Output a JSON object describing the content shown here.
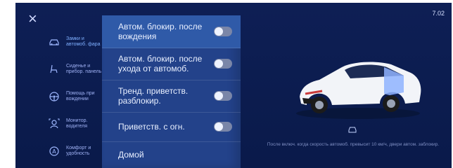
{
  "status": {
    "time": "7.02"
  },
  "close_icon": "close-icon",
  "sidebar": {
    "items": [
      {
        "label": "Замки и автомоб. фара",
        "icon": "car-lock-icon",
        "active": true
      },
      {
        "label": "Сиденье и прибор. панель",
        "icon": "seat-icon",
        "active": false
      },
      {
        "label": "Помощь при вождении",
        "icon": "steering-wheel-icon",
        "active": false
      },
      {
        "label": "Монитор. водителя",
        "icon": "driver-monitor-icon",
        "active": false
      },
      {
        "label": "Комфорт и удобность",
        "icon": "comfort-icon",
        "active": false
      }
    ]
  },
  "options": [
    {
      "label": "Автом. блокир. после вождения",
      "enabled": false
    },
    {
      "label": "Автом. блокир. после ухода от автомоб.",
      "enabled": false
    },
    {
      "label": "Тренд. приветств. разблокир.",
      "enabled": false
    },
    {
      "label": "Приветств. с огн.",
      "enabled": false
    },
    {
      "label": "Домой",
      "enabled": null
    }
  ],
  "preview": {
    "caption": "После включ. когда скорость автомоб. превысит 10 км/ч, двери автом. заблокир."
  },
  "colors": {
    "background": "#0a1a4a",
    "panel": "#23428a",
    "selected": "#2f5aa8",
    "accent": "#7fb0ff"
  }
}
